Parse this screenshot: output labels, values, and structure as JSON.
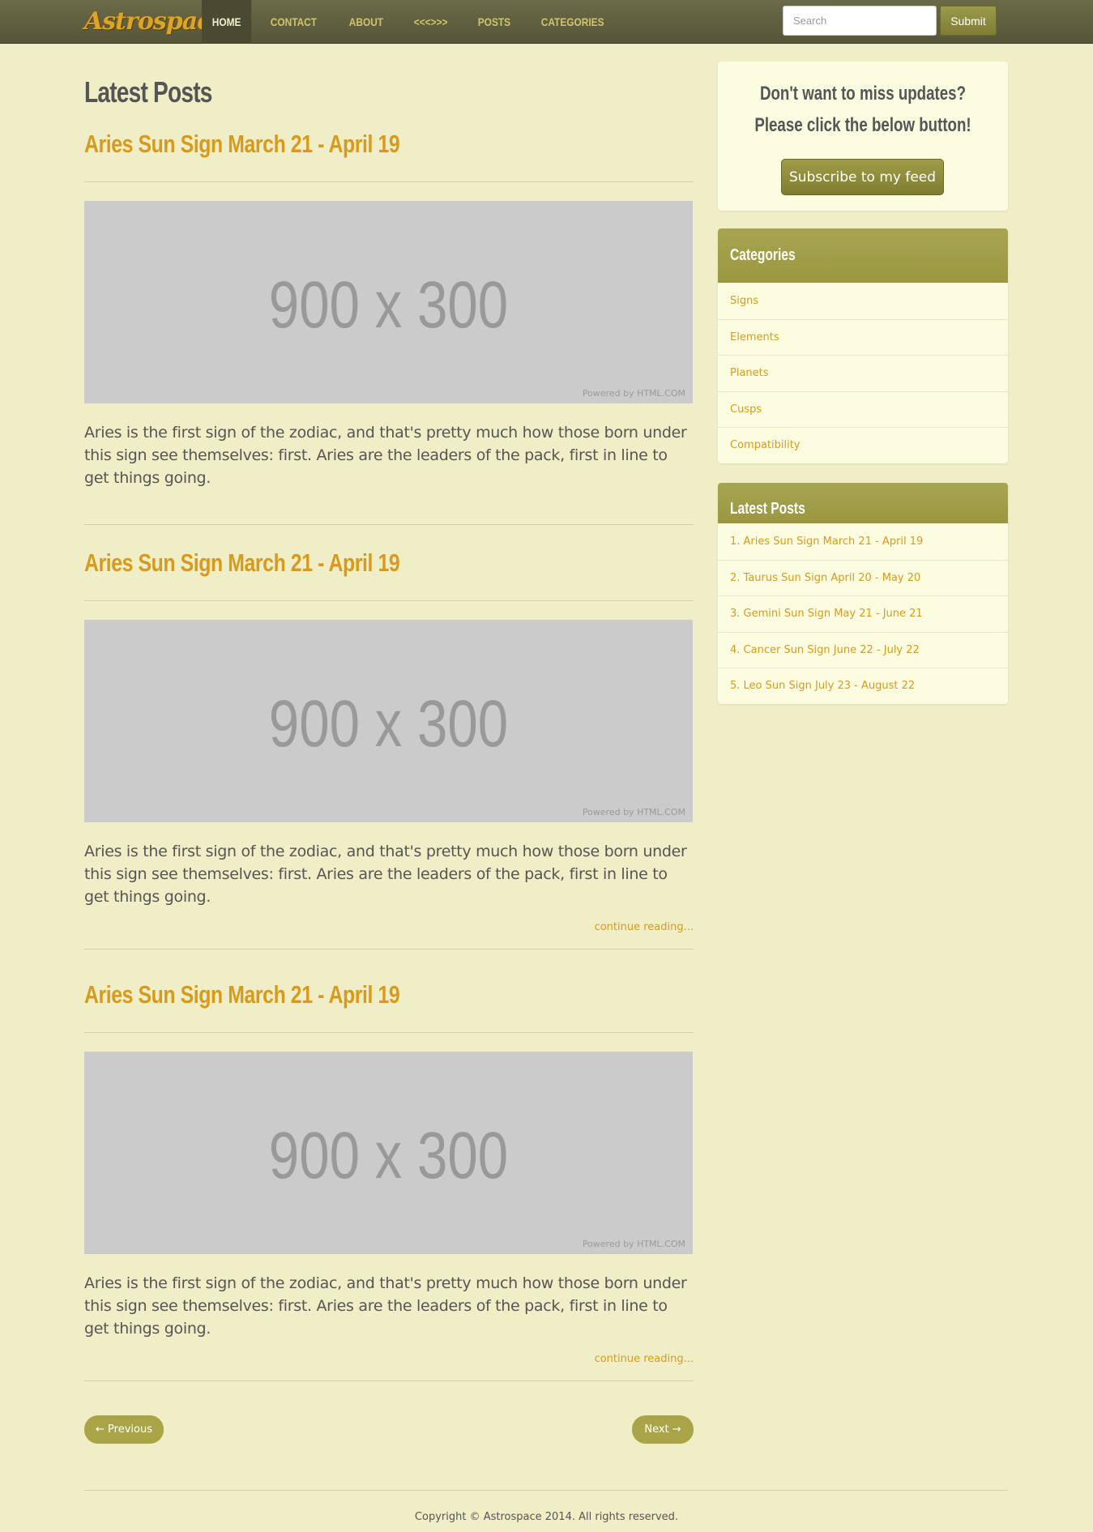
{
  "navbar": {
    "brand": "Astrospace",
    "items": [
      {
        "label": "HOME",
        "active": true
      },
      {
        "label": "CONTACT",
        "active": false
      },
      {
        "label": "ABOUT",
        "active": false
      },
      {
        "label": "<<<>>>",
        "active": false
      },
      {
        "label": "POSTS",
        "active": false
      },
      {
        "label": "CATEGORIES",
        "active": false
      }
    ],
    "search_placeholder": "Search",
    "submit_label": "Submit"
  },
  "main": {
    "title": "Latest Posts",
    "posts": [
      {
        "title": "Aries Sun Sign March 21 - April 19",
        "image_text": "900 x 300",
        "image_credit": "Powered by HTML.COM",
        "excerpt": "Aries is the first sign of the zodiac, and that's pretty much how those born under this sign see themselves: first. Aries are the leaders of the pack, first in line to get things going.",
        "continue_label": ""
      },
      {
        "title": "Aries Sun Sign March 21 - April 19",
        "image_text": "900 x 300",
        "image_credit": "Powered by HTML.COM",
        "excerpt": "Aries is the first sign of the zodiac, and that's pretty much how those born under this sign see themselves: first. Aries are the leaders of the pack, first in line to get things going.",
        "continue_label": "continue reading..."
      },
      {
        "title": "Aries Sun Sign March 21 - April 19",
        "image_text": "900 x 300",
        "image_credit": "Powered by HTML.COM",
        "excerpt": "Aries is the first sign of the zodiac, and that's pretty much how those born under this sign see themselves: first. Aries are the leaders of the pack, first in line to get things going.",
        "continue_label": "continue reading..."
      }
    ],
    "pager": {
      "previous_label": "← Previous",
      "next_label": "Next →"
    }
  },
  "sidebar": {
    "subscribe": {
      "text": "Don't want to miss updates? Please click the below button!",
      "button_label": "Subscribe to my feed"
    },
    "categories": {
      "heading": "Categories",
      "items": [
        "Signs",
        "Elements",
        "Planets",
        "Cusps",
        "Compatibility"
      ]
    },
    "latest_posts": {
      "heading": "Latest Posts",
      "items": [
        "1. Aries Sun Sign March 21 - April 19",
        "2. Taurus Sun Sign April 20 - May 20",
        "3. Gemini Sun Sign May 21 - June 21",
        "4. Cancer Sun Sign June 22 - July 22",
        "5. Leo Sun Sign July 23 - August 22"
      ]
    }
  },
  "footer": {
    "copyright": "Copyright © Astrospace 2014. All rights reserved."
  },
  "colors": {
    "background": "#f0eec6",
    "navbar": "#5f5f40",
    "link": "#d89a1c",
    "accent": "#aaa449",
    "panel": "#fcfde0"
  }
}
